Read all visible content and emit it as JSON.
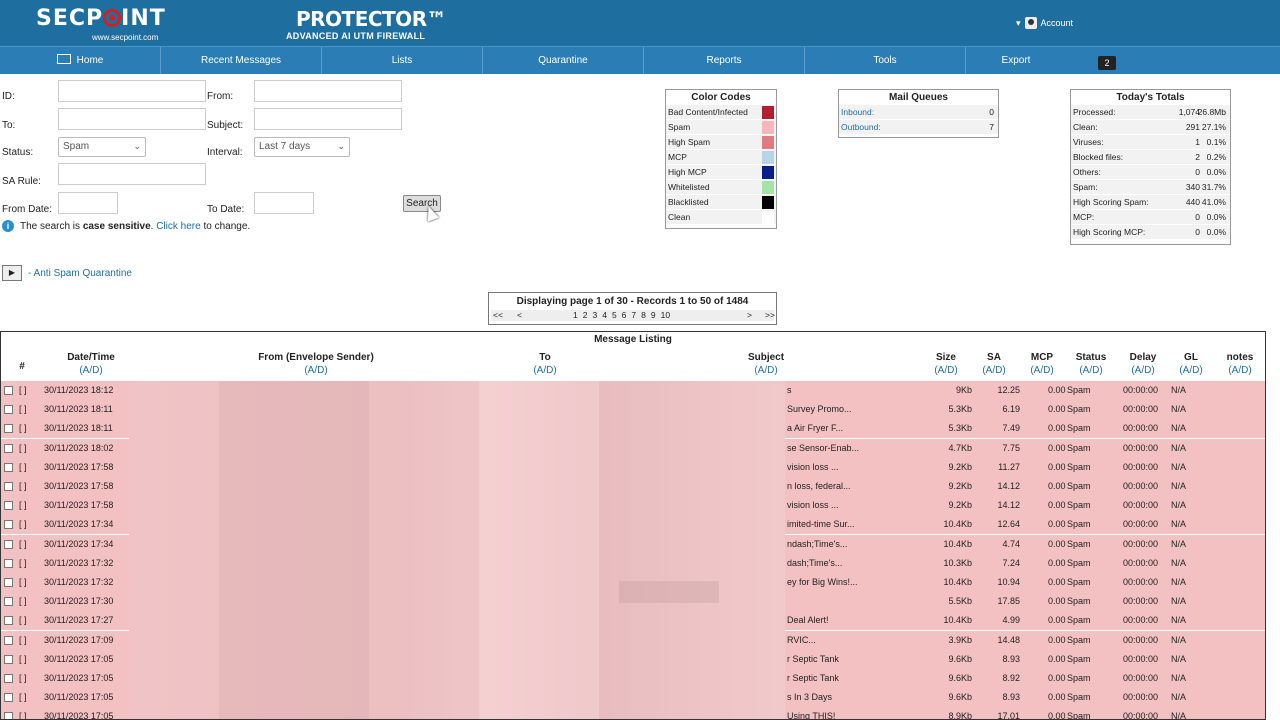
{
  "header": {
    "logo_text": "SECP INT",
    "logo_url": "www.secpoint.com",
    "product": "PROTECTOR™",
    "product_sub": "ADVANCED AI UTM FIREWALL",
    "account": "Account"
  },
  "nav": {
    "items": [
      "Home",
      "Recent Messages",
      "Lists",
      "Quarantine",
      "Reports",
      "Tools",
      "Export"
    ],
    "badge": "2"
  },
  "form": {
    "id_label": "ID:",
    "from_label": "From:",
    "to_label": "To:",
    "subject_label": "Subject:",
    "status_label": "Status:",
    "status_value": "Spam",
    "interval_label": "Interval:",
    "interval_value": "Last 7 days",
    "sarule_label": "SA Rule:",
    "fromdate_label": "From Date:",
    "todate_label": "To Date:",
    "search_label": "Search",
    "info_prefix": "The search is ",
    "info_bold": "case sensitive",
    "info_mid": ". ",
    "info_link": "Click here",
    "info_suffix": " to change."
  },
  "color_codes": {
    "title": "Color Codes",
    "items": [
      {
        "label": "Bad Content/Infected",
        "color": "#b02030"
      },
      {
        "label": "Spam",
        "color": "#f4b8bb"
      },
      {
        "label": "High Spam",
        "color": "#e07a80"
      },
      {
        "label": "MCP",
        "color": "#b8d4e8"
      },
      {
        "label": "High MCP",
        "color": "#0a1f8a"
      },
      {
        "label": "Whitelisted",
        "color": "#a4e4a4"
      },
      {
        "label": "Blacklisted",
        "color": "#000000"
      },
      {
        "label": "Clean",
        "color": "#ffffff"
      }
    ]
  },
  "mail_queues": {
    "title": "Mail Queues",
    "items": [
      {
        "label": "Inbound:",
        "value": "0"
      },
      {
        "label": "Outbound:",
        "value": "7"
      }
    ]
  },
  "totals": {
    "title": "Today's Totals",
    "items": [
      {
        "label": "Processed:",
        "count": "1,074",
        "pct": "26.8Mb"
      },
      {
        "label": "Clean:",
        "count": "291",
        "pct": "27.1%"
      },
      {
        "label": "Viruses:",
        "count": "1",
        "pct": "0.1%"
      },
      {
        "label": "Blocked files:",
        "count": "2",
        "pct": "0.2%"
      },
      {
        "label": "Others:",
        "count": "0",
        "pct": "0.0%"
      },
      {
        "label": "Spam:",
        "count": "340",
        "pct": "31.7%"
      },
      {
        "label": "High Scoring Spam:",
        "count": "440",
        "pct": "41.0%"
      },
      {
        "label": "MCP:",
        "count": "0",
        "pct": "0.0%"
      },
      {
        "label": "High Scoring MCP:",
        "count": "0",
        "pct": "0.0%"
      }
    ]
  },
  "quarantine_link": "- Anti Spam Quarantine",
  "pager": {
    "text": "Displaying page 1 of 30 - Records 1 to 50 of 1484",
    "first": "<<",
    "prev": "<",
    "pages": [
      "1",
      "2",
      "3",
      "4",
      "5",
      "6",
      "7",
      "8",
      "9",
      "10"
    ],
    "next": ">",
    "last": ">>"
  },
  "listing": {
    "title": "Message Listing",
    "sort": "(A/D)",
    "columns": [
      "#",
      "Date/Time",
      "From (Envelope Sender)",
      "To",
      "Subject",
      "Size",
      "SA",
      "MCP",
      "Status",
      "Delay",
      "GL",
      "notes"
    ],
    "rows": [
      {
        "date": "30/11/2023 18:12",
        "subject": "s",
        "size": "9Kb",
        "sa": "12.25",
        "mcp": "0.00",
        "status": "Spam",
        "delay": "00:00:00",
        "gl": "N/A"
      },
      {
        "date": "30/11/2023 18:11",
        "subject": "Survey Promo...",
        "size": "5.3Kb",
        "sa": "6.19",
        "mcp": "0.00",
        "status": "Spam",
        "delay": "00:00:00",
        "gl": "N/A"
      },
      {
        "date": "30/11/2023 18:11",
        "subject": "a Air Fryer F...",
        "size": "5.3Kb",
        "sa": "7.49",
        "mcp": "0.00",
        "status": "Spam",
        "delay": "00:00:00",
        "gl": "N/A"
      },
      {
        "date": "30/11/2023 18:02",
        "subject": "se Sensor-Enab...",
        "size": "4.7Kb",
        "sa": "7.75",
        "mcp": "0.00",
        "status": "Spam",
        "delay": "00:00:00",
        "gl": "N/A"
      },
      {
        "date": "30/11/2023 17:58",
        "subject": "vision loss ...",
        "size": "9.2Kb",
        "sa": "11.27",
        "mcp": "0.00",
        "status": "Spam",
        "delay": "00:00:00",
        "gl": "N/A"
      },
      {
        "date": "30/11/2023 17:58",
        "subject": "n loss, federal...",
        "size": "9.2Kb",
        "sa": "14.12",
        "mcp": "0.00",
        "status": "Spam",
        "delay": "00:00:00",
        "gl": "N/A"
      },
      {
        "date": "30/11/2023 17:58",
        "subject": "vision loss ...",
        "size": "9.2Kb",
        "sa": "14.12",
        "mcp": "0.00",
        "status": "Spam",
        "delay": "00:00:00",
        "gl": "N/A"
      },
      {
        "date": "30/11/2023 17:34",
        "subject": "imited-time Sur...",
        "size": "10.4Kb",
        "sa": "12.64",
        "mcp": "0.00",
        "status": "Spam",
        "delay": "00:00:00",
        "gl": "N/A"
      },
      {
        "date": "30/11/2023 17:34",
        "subject": "ndash;Time's...",
        "size": "10.4Kb",
        "sa": "4.74",
        "mcp": "0.00",
        "status": "Spam",
        "delay": "00:00:00",
        "gl": "N/A"
      },
      {
        "date": "30/11/2023 17:32",
        "subject": "dash;Time's...",
        "size": "10.3Kb",
        "sa": "7.24",
        "mcp": "0.00",
        "status": "Spam",
        "delay": "00:00:00",
        "gl": "N/A"
      },
      {
        "date": "30/11/2023 17:32",
        "subject": "ey for Big Wins!...",
        "size": "10.4Kb",
        "sa": "10.94",
        "mcp": "0.00",
        "status": "Spam",
        "delay": "00:00:00",
        "gl": "N/A"
      },
      {
        "date": "30/11/2023 17:30",
        "subject": "",
        "size": "5.5Kb",
        "sa": "17.85",
        "mcp": "0.00",
        "status": "Spam",
        "delay": "00:00:00",
        "gl": "N/A"
      },
      {
        "date": "30/11/2023 17:27",
        "subject": "Deal Alert!",
        "size": "10.4Kb",
        "sa": "4.99",
        "mcp": "0.00",
        "status": "Spam",
        "delay": "00:00:00",
        "gl": "N/A"
      },
      {
        "date": "30/11/2023 17:09",
        "subject": "RVIC...",
        "size": "3.9Kb",
        "sa": "14.48",
        "mcp": "0.00",
        "status": "Spam",
        "delay": "00:00:00",
        "gl": "N/A"
      },
      {
        "date": "30/11/2023 17:05",
        "subject": "r Septic Tank",
        "size": "9.6Kb",
        "sa": "8.93",
        "mcp": "0.00",
        "status": "Spam",
        "delay": "00:00:00",
        "gl": "N/A"
      },
      {
        "date": "30/11/2023 17:05",
        "subject": "r Septic Tank",
        "size": "9.6Kb",
        "sa": "8.92",
        "mcp": "0.00",
        "status": "Spam",
        "delay": "00:00:00",
        "gl": "N/A"
      },
      {
        "date": "30/11/2023 17:05",
        "subject": "s In 3 Days",
        "size": "9.6Kb",
        "sa": "8.93",
        "mcp": "0.00",
        "status": "Spam",
        "delay": "00:00:00",
        "gl": "N/A"
      },
      {
        "date": "30/11/2023 17:05",
        "subject": "Using THIS!",
        "size": "8.9Kb",
        "sa": "17.01",
        "mcp": "0.00",
        "status": "Spam",
        "delay": "00:00:00",
        "gl": "N/A"
      }
    ]
  }
}
